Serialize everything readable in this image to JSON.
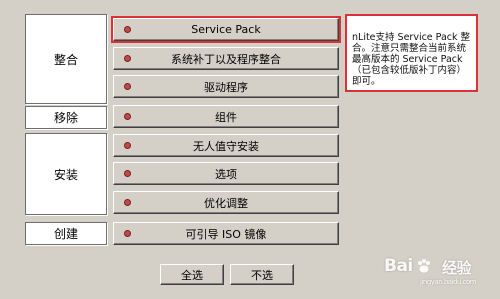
{
  "groups": {
    "integrate": "整合",
    "remove": "移除",
    "setup": "安装",
    "create": "创建"
  },
  "tasks": [
    {
      "label": "Service Pack",
      "group": "integrate",
      "highlighted": true
    },
    {
      "label": "系统补丁以及程序整合",
      "group": "integrate"
    },
    {
      "label": "驱动程序",
      "group": "integrate"
    },
    {
      "label": "组件",
      "group": "remove"
    },
    {
      "label": "无人值守安装",
      "group": "setup"
    },
    {
      "label": "选项",
      "group": "setup"
    },
    {
      "label": "优化调整",
      "group": "setup"
    },
    {
      "label": "可引导 ISO 镜像",
      "group": "create"
    }
  ],
  "note": {
    "text": "nLite支持 Service Pack 整合。注意只需整合当前系统最高版本的 Service Pack（已包含较低版补丁内容）即可。"
  },
  "buttons": {
    "select_all": "全选",
    "select_none": "不选"
  },
  "watermark": {
    "brand": "Bai",
    "brand_tail": "经验",
    "url": "jingyan.baidu.com"
  },
  "colors": {
    "dot": "#c04a4a",
    "highlight": "#d9333a",
    "face": "#d4d0c8"
  }
}
